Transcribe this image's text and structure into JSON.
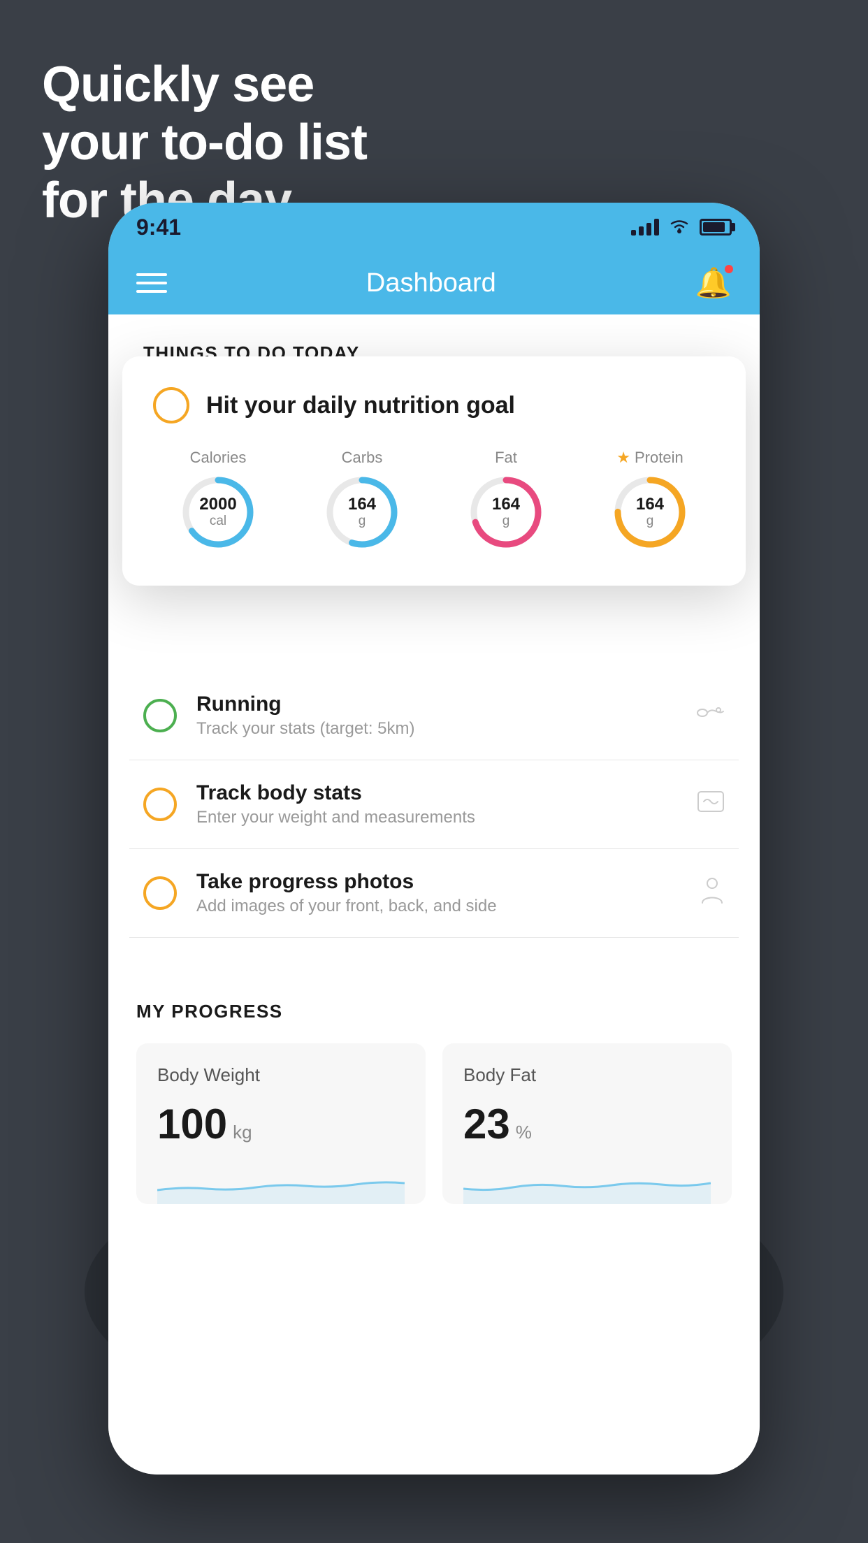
{
  "hero": {
    "line1": "Quickly see",
    "line2": "your to-do list",
    "line3": "for the day."
  },
  "phone": {
    "statusBar": {
      "time": "9:41"
    },
    "navBar": {
      "title": "Dashboard"
    },
    "thingsToDoHeader": "THINGS TO DO TODAY",
    "floatingCard": {
      "circleColor": "#f5a623",
      "title": "Hit your daily nutrition goal",
      "nutrition": [
        {
          "label": "Calories",
          "value": "2000",
          "unit": "cal",
          "color": "#4ab8e8",
          "percent": 65
        },
        {
          "label": "Carbs",
          "value": "164",
          "unit": "g",
          "color": "#4ab8e8",
          "percent": 55
        },
        {
          "label": "Fat",
          "value": "164",
          "unit": "g",
          "color": "#e84a7f",
          "percent": 70
        },
        {
          "label": "Protein",
          "value": "164",
          "unit": "g",
          "color": "#f5a623",
          "percent": 75,
          "star": true
        }
      ]
    },
    "todoItems": [
      {
        "type": "green",
        "title": "Running",
        "subtitle": "Track your stats (target: 5km)",
        "icon": "👟"
      },
      {
        "type": "yellow",
        "title": "Track body stats",
        "subtitle": "Enter your weight and measurements",
        "icon": "⚖️"
      },
      {
        "type": "yellow",
        "title": "Take progress photos",
        "subtitle": "Add images of your front, back, and side",
        "icon": "👤"
      }
    ],
    "progressSection": {
      "header": "MY PROGRESS",
      "cards": [
        {
          "title": "Body Weight",
          "value": "100",
          "unit": "kg"
        },
        {
          "title": "Body Fat",
          "value": "23",
          "unit": "%"
        }
      ]
    }
  }
}
